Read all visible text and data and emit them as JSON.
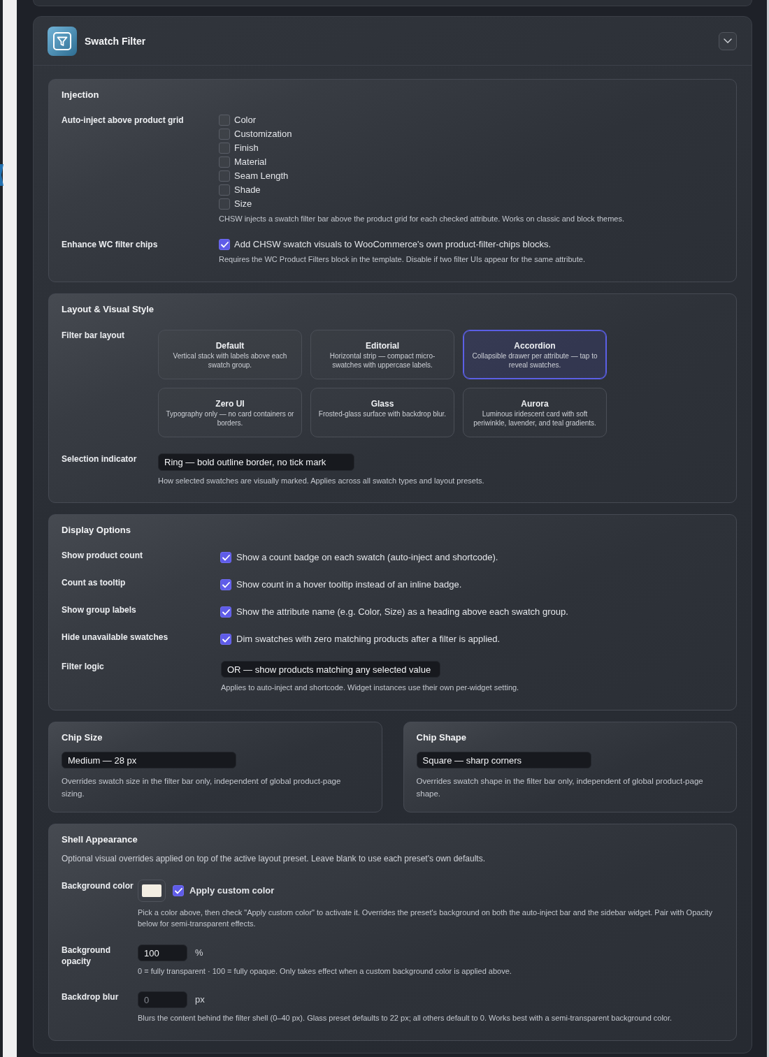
{
  "panel": {
    "title": "Swatch Filter"
  },
  "injection": {
    "title": "Injection",
    "auto_inject": {
      "label": "Auto-inject above product grid",
      "options": [
        {
          "label": "Color",
          "checked": false
        },
        {
          "label": "Customization",
          "checked": false
        },
        {
          "label": "Finish",
          "checked": false
        },
        {
          "label": "Material",
          "checked": false
        },
        {
          "label": "Seam Length",
          "checked": false
        },
        {
          "label": "Shade",
          "checked": false
        },
        {
          "label": "Size",
          "checked": false
        }
      ],
      "help": "CHSW injects a swatch filter bar above the product grid for each checked attribute. Works on classic and block themes."
    },
    "enhance_chips": {
      "label": "Enhance WC filter chips",
      "checked": true,
      "text": "Add CHSW swatch visuals to WooCommerce's own product-filter-chips blocks.",
      "help": "Requires the WC Product Filters block in the template. Disable if two filter UIs appear for the same attribute."
    }
  },
  "layout_style": {
    "title": "Layout & Visual Style",
    "filter_bar_layout": {
      "label": "Filter bar layout",
      "presets": [
        {
          "name": "Default",
          "description": "Vertical stack with labels above each swatch group.",
          "selected": false
        },
        {
          "name": "Editorial",
          "description": "Horizontal strip — compact micro-swatches with uppercase labels.",
          "selected": false
        },
        {
          "name": "Accordion",
          "description": "Collapsible drawer per attribute — tap to reveal swatches.",
          "selected": true
        },
        {
          "name": "Zero UI",
          "description": "Typography only — no card containers or borders.",
          "selected": false
        },
        {
          "name": "Glass",
          "description": "Frosted-glass surface with backdrop blur.",
          "selected": false
        },
        {
          "name": "Aurora",
          "description": "Luminous iridescent card with soft periwinkle, lavender, and teal gradients.",
          "selected": false
        }
      ]
    },
    "selection_indicator": {
      "label": "Selection indicator",
      "value": "Ring — bold outline border, no tick mark",
      "help": "How selected swatches are visually marked. Applies across all swatch types and layout presets."
    }
  },
  "display_options": {
    "title": "Display Options",
    "toggles": [
      {
        "label": "Show product count",
        "checked": true,
        "text": "Show a count badge on each swatch (auto-inject and shortcode)."
      },
      {
        "label": "Count as tooltip",
        "checked": true,
        "text": "Show count in a hover tooltip instead of an inline badge."
      },
      {
        "label": "Show group labels",
        "checked": true,
        "text": "Show the attribute name (e.g. Color, Size) as a heading above each swatch group."
      },
      {
        "label": "Hide unavailable swatches",
        "checked": true,
        "text": "Dim swatches with zero matching products after a filter is applied."
      }
    ],
    "filter_logic": {
      "label": "Filter logic",
      "value": "OR — show products matching any selected value",
      "help": "Applies to auto-inject and shortcode. Widget instances use their own per-widget setting."
    }
  },
  "chip_size": {
    "title": "Chip Size",
    "value": "Medium — 28 px",
    "help": "Overrides swatch size in the filter bar only, independent of global product-page sizing."
  },
  "chip_shape": {
    "title": "Chip Shape",
    "value": "Square — sharp corners",
    "help": "Overrides swatch shape in the filter bar only, independent of global product-page shape."
  },
  "shell_appearance": {
    "title": "Shell Appearance",
    "description": "Optional visual overrides applied on top of the active layout preset. Leave blank to use each preset's own defaults.",
    "background_color": {
      "label": "Background color",
      "color": "#f3eee3",
      "apply": {
        "label": "Apply custom color",
        "checked": true
      },
      "help": "Pick a color above, then check \"Apply custom color\" to activate it. Overrides the preset's background on both the auto-inject bar and the sidebar widget. Pair with Opacity below for semi-transparent effects."
    },
    "opacity": {
      "label": "Background opacity",
      "value": "100",
      "unit": "%",
      "help": "0 = fully transparent · 100 = fully opaque. Only takes effect when a custom background color is applied above."
    },
    "blur": {
      "label": "Backdrop blur",
      "placeholder": "0",
      "unit": "px",
      "help": "Blurs the content behind the filter shell (0–40 px). Glass preset defaults to 22 px; all others default to 0. Works best with a semi-transparent background color."
    }
  }
}
